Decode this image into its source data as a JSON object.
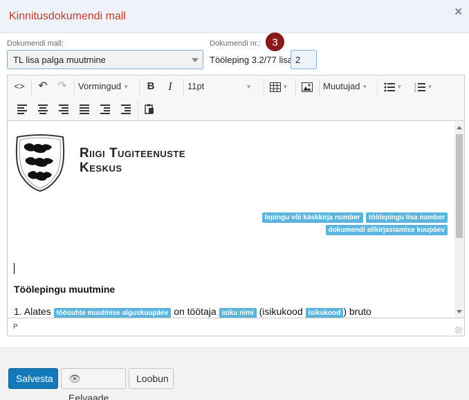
{
  "dialog": {
    "title": "Kinnitusdokumendi mall"
  },
  "template_field": {
    "label": "Dokumendi mall:",
    "value": "TL lisa palga muutmine"
  },
  "doc_number": {
    "label": "Dokumendi nr.:",
    "prefix": "Tööleping 3.2/77 lisa",
    "value": "2"
  },
  "badge": "3",
  "toolbar": {
    "code_icon": "<>",
    "format_label": "Vormingud",
    "bold_label": "B",
    "italic_label": "I",
    "font_size_label": "11pt",
    "variables_label": "Muutujad"
  },
  "document": {
    "org_line1": "Riigi Tugiteenuste",
    "org_line2": "Keskus",
    "tag_contract_number": "lepingu või käskkirja number",
    "tag_appendix_number": "töölepingu lisa number",
    "tag_sign_date": "dokumendi allkirjastamise kuupäev",
    "heading": "Töölepingu muutmine",
    "para_prefix": "1. Alates",
    "tag_change_date": "töösuhte muutmise alguskuupäev",
    "para_mid": "on töötaja",
    "tag_name": "isiku nimi",
    "para_mid2": "(isikukood",
    "tag_idcode": "isikukood",
    "para_end": ") bruto"
  },
  "status_path": "P",
  "buttons": {
    "save": "Salvesta",
    "preview": "Eelvaade",
    "cancel": "Loobun"
  },
  "colors": {
    "title": "#c0392b",
    "badge": "#8b1a1a",
    "tag": "#5bb4dd",
    "primary": "#1479b8"
  }
}
